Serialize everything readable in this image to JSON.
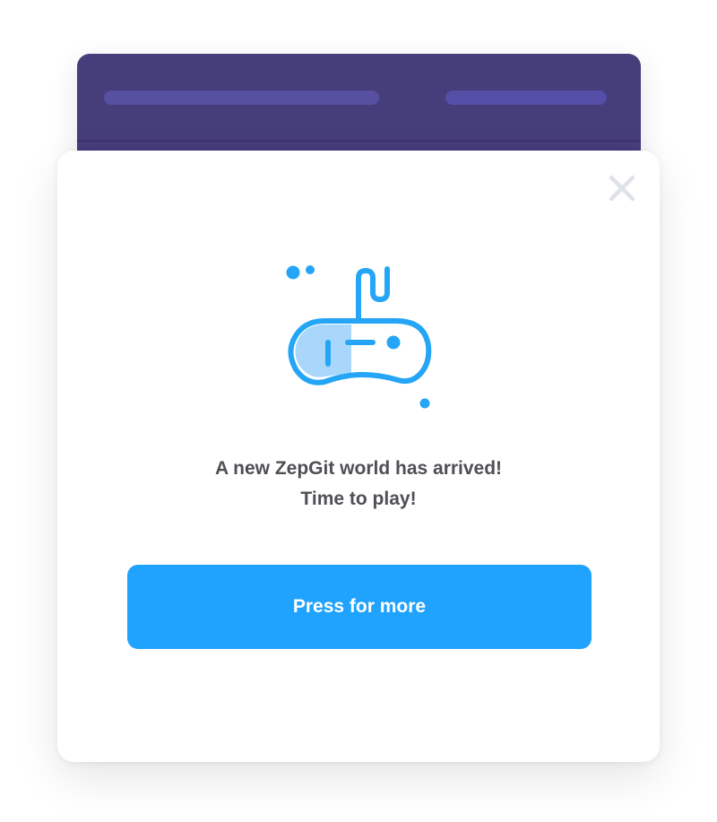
{
  "modal": {
    "message_line1": "A new ZepGit world has arrived!",
    "message_line2": "Time to play!",
    "button_label": "Press for more",
    "close_icon": "close-icon",
    "illustration_icon": "gamepad-icon"
  },
  "colors": {
    "window_header": "#463d7b",
    "placeholder_bar": "#5a52a6",
    "accent_blue": "#1fa3ff",
    "icon_blue": "#25a5f5",
    "icon_fill_light": "#a8d7fb",
    "text": "#4f4f55",
    "close_icon": "#dfe3e8"
  }
}
